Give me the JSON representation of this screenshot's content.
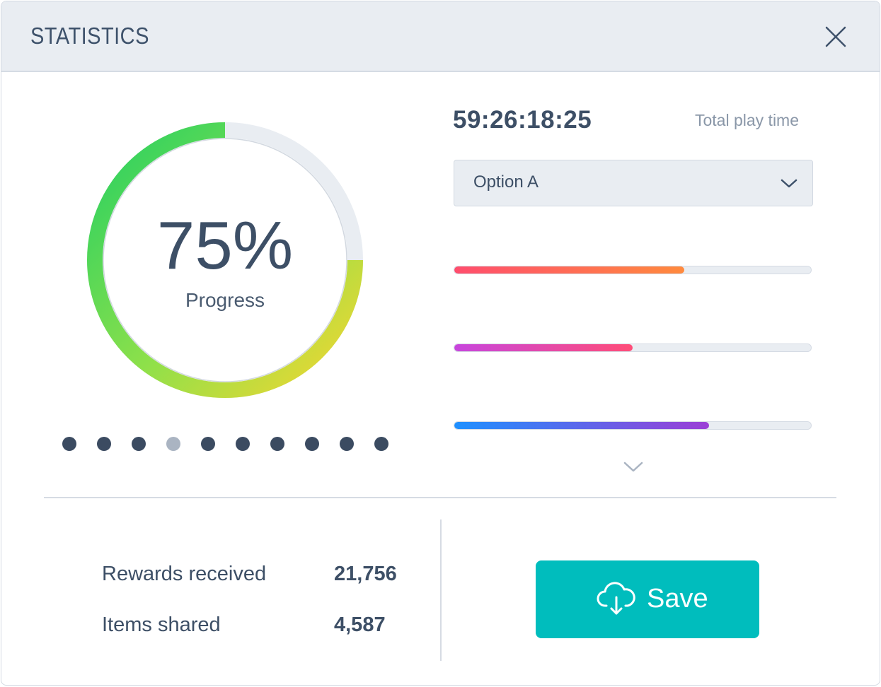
{
  "header": {
    "title": "STATISTICS",
    "close_icon": "close-icon"
  },
  "progress": {
    "percent_text": "75%",
    "label": "Progress",
    "value": 0.75
  },
  "pagination": {
    "count": 10,
    "active_index": 3
  },
  "play_time": {
    "value": "59:26:18:25",
    "label": "Total play time"
  },
  "select": {
    "value": "Option A",
    "icon": "chevron-down-icon"
  },
  "bars": [
    {
      "fraction": 0.645,
      "color_start": "#ff4d6d",
      "color_end": "#ff8a3d"
    },
    {
      "fraction": 0.5,
      "color_start": "#c745dd",
      "color_end": "#ff4d78"
    },
    {
      "fraction": 0.715,
      "color_start": "#1e90ff",
      "color_end": "#9b3fd6"
    }
  ],
  "stats": [
    {
      "label": "Rewards received",
      "value": "21,756"
    },
    {
      "label": "Items shared",
      "value": "4,587"
    }
  ],
  "save_button": {
    "label": "Save",
    "icon": "cloud-download-icon"
  },
  "colors": {
    "accent": "#00bdbd",
    "ring_track": "#e9edf2",
    "ring_green": "#2fd15f",
    "ring_yellow": "#f6d72f",
    "text": "#3d4f66"
  }
}
